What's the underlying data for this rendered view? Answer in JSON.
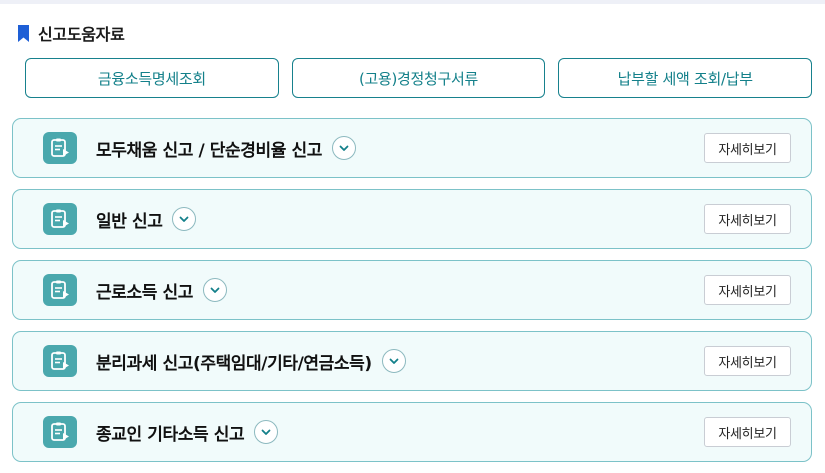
{
  "section": {
    "title": "신고도움자료",
    "accent_color": "#1e5fd6"
  },
  "quick_links": [
    {
      "label": "금융소득명세조회"
    },
    {
      "label": "(고용)경정청구서류"
    },
    {
      "label": "납부할 세액 조회/납부"
    }
  ],
  "cards": [
    {
      "title": "모두채움 신고 / 단순경비율 신고",
      "detail_label": "자세히보기",
      "icon": "document-play-icon"
    },
    {
      "title": "일반 신고",
      "detail_label": "자세히보기",
      "icon": "document-play-icon"
    },
    {
      "title": "근로소득 신고",
      "detail_label": "자세히보기",
      "icon": "document-play-icon"
    },
    {
      "title": "분리과세 신고(주택임대/기타/연금소득)",
      "detail_label": "자세히보기",
      "icon": "document-play-icon"
    },
    {
      "title": "종교인 기타소득 신고",
      "detail_label": "자세히보기",
      "icon": "document-play-icon"
    }
  ],
  "colors": {
    "teal": "#13808a",
    "card_bg": "#f1fbfb",
    "card_border": "#7cc2c8",
    "icon_bg": "#4aa8ad"
  }
}
